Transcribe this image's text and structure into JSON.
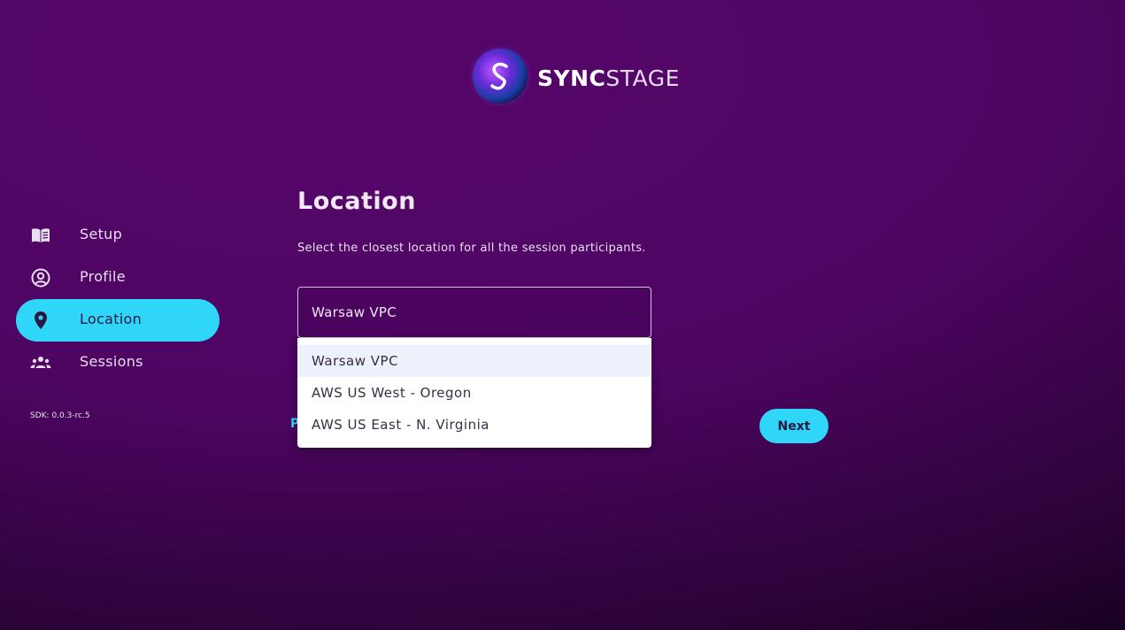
{
  "brand": {
    "sync": "SYNC",
    "stage": "STAGE"
  },
  "sidebar": {
    "items": [
      {
        "label": "Setup",
        "icon": "book-icon",
        "active": false
      },
      {
        "label": "Profile",
        "icon": "account-circle-icon",
        "active": false
      },
      {
        "label": "Location",
        "icon": "map-pin-icon",
        "active": true
      },
      {
        "label": "Sessions",
        "icon": "group-icon",
        "active": false
      }
    ],
    "sdk_version": "SDK: 0.0.3-rc.5"
  },
  "main": {
    "title": "Location",
    "subtitle": "Select the closest location for all the session participants.",
    "select": {
      "value": "Warsaw VPC",
      "options": [
        "Warsaw VPC",
        "AWS US West - Oregon",
        "AWS US East - N. Virginia"
      ],
      "selected_index": 0
    },
    "back_peek": "P",
    "next_label": "Next"
  },
  "colors": {
    "accent": "#2fd6f8",
    "background": "#4e0562",
    "active_text": "#2b1840"
  }
}
